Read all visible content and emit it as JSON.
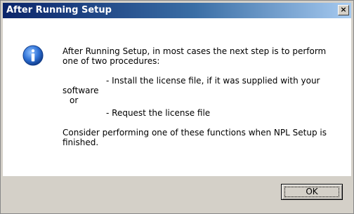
{
  "dialog": {
    "title": "After Running Setup",
    "close_label": "×",
    "message": {
      "intro_line1": "After Running Setup, in most cases the next step is to perform",
      "intro_line2": "one of two procedures:",
      "option1_line1": "- Install the license file, if it was supplied with your",
      "option1_line2": "software",
      "or_text": "or",
      "option2": "- Request the license file",
      "closing_line1": "Consider performing one of these functions when NPL Setup is",
      "closing_line2": "finished."
    },
    "ok_label": "OK",
    "icon": "information-icon"
  },
  "colors": {
    "title_bar_start": "#0a246a",
    "title_bar_end": "#a6caf0",
    "icon_blue": "#1f5fbf",
    "dialog_face": "#d4d0c8"
  }
}
